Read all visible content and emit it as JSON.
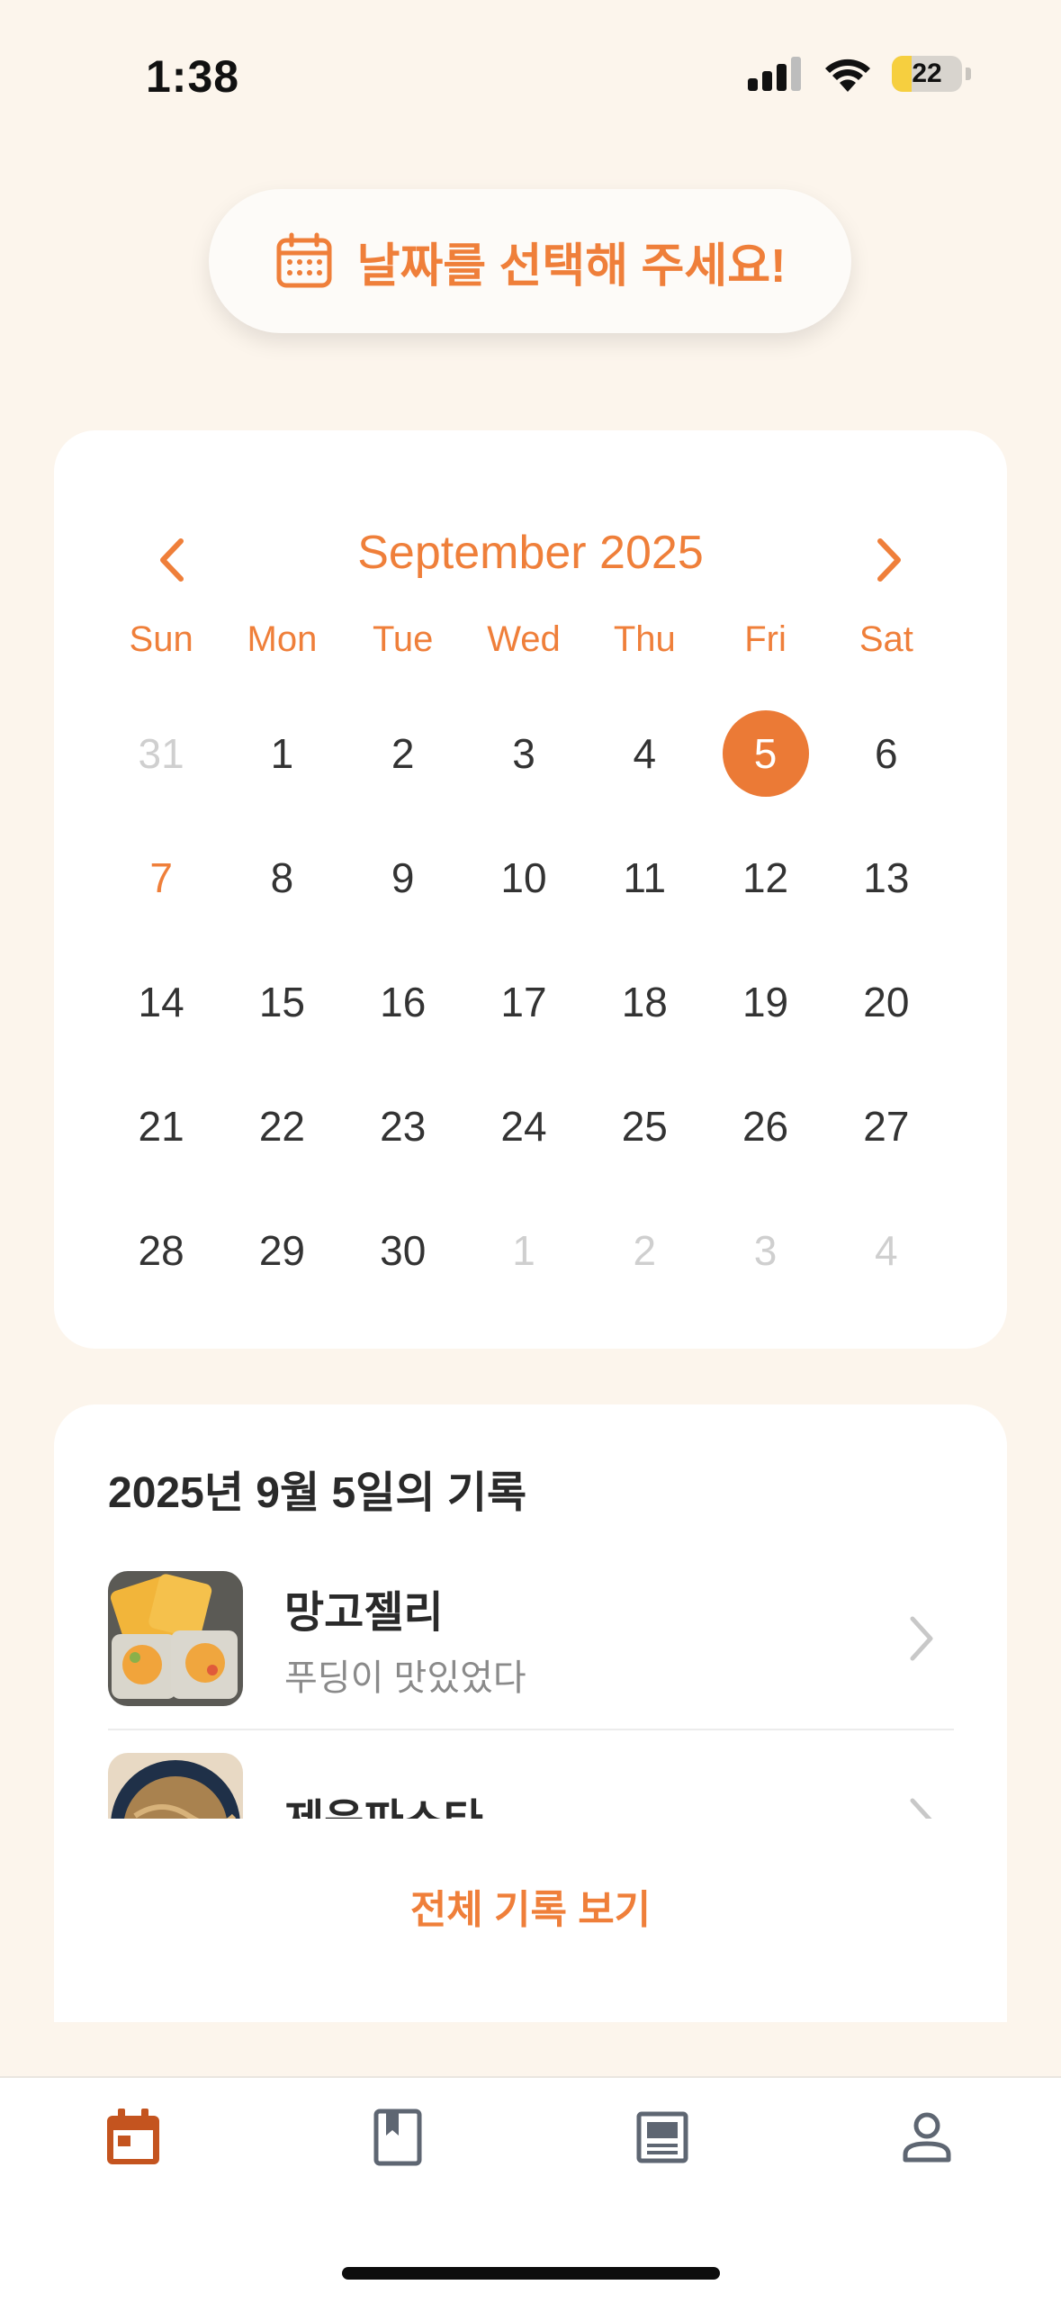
{
  "status_bar": {
    "time": "1:38",
    "battery": "22"
  },
  "header": {
    "pill_text": "날짜를 선택해 주세요!",
    "icon": "calendar-icon"
  },
  "calendar": {
    "month_label": "September 2025",
    "weekdays": [
      "Sun",
      "Mon",
      "Tue",
      "Wed",
      "Thu",
      "Fri",
      "Sat"
    ],
    "days": [
      {
        "label": "31",
        "state": "muted"
      },
      {
        "label": "1",
        "state": ""
      },
      {
        "label": "2",
        "state": ""
      },
      {
        "label": "3",
        "state": ""
      },
      {
        "label": "4",
        "state": ""
      },
      {
        "label": "5",
        "state": "selected"
      },
      {
        "label": "6",
        "state": ""
      },
      {
        "label": "7",
        "state": "today"
      },
      {
        "label": "8",
        "state": ""
      },
      {
        "label": "9",
        "state": ""
      },
      {
        "label": "10",
        "state": ""
      },
      {
        "label": "11",
        "state": ""
      },
      {
        "label": "12",
        "state": ""
      },
      {
        "label": "13",
        "state": ""
      },
      {
        "label": "14",
        "state": ""
      },
      {
        "label": "15",
        "state": ""
      },
      {
        "label": "16",
        "state": ""
      },
      {
        "label": "17",
        "state": ""
      },
      {
        "label": "18",
        "state": ""
      },
      {
        "label": "19",
        "state": ""
      },
      {
        "label": "20",
        "state": ""
      },
      {
        "label": "21",
        "state": ""
      },
      {
        "label": "22",
        "state": ""
      },
      {
        "label": "23",
        "state": ""
      },
      {
        "label": "24",
        "state": ""
      },
      {
        "label": "25",
        "state": ""
      },
      {
        "label": "26",
        "state": ""
      },
      {
        "label": "27",
        "state": ""
      },
      {
        "label": "28",
        "state": ""
      },
      {
        "label": "29",
        "state": ""
      },
      {
        "label": "30",
        "state": ""
      },
      {
        "label": "1",
        "state": "muted"
      },
      {
        "label": "2",
        "state": "muted"
      },
      {
        "label": "3",
        "state": "muted"
      },
      {
        "label": "4",
        "state": "muted"
      }
    ]
  },
  "records": {
    "title": "2025년 9월 5일의 기록",
    "items": [
      {
        "name": "망고젤리",
        "description": "푸딩이 맛있었다",
        "thumb": "mango-jelly-photo"
      },
      {
        "name": "제육파스타",
        "description": "",
        "thumb": "pasta-photo"
      }
    ],
    "view_all": "전체 기록 보기"
  },
  "tab_bar": {
    "tabs": [
      {
        "icon": "calendar-tab-icon",
        "active": true
      },
      {
        "icon": "bookmark-book-tab-icon",
        "active": false
      },
      {
        "icon": "article-tab-icon",
        "active": false
      },
      {
        "icon": "profile-tab-icon",
        "active": false
      }
    ]
  },
  "colors": {
    "accent": "#EF7F3A",
    "background": "#FCF5EC",
    "active_tab": "#C4541F",
    "inactive_tab": "#5E6672"
  }
}
